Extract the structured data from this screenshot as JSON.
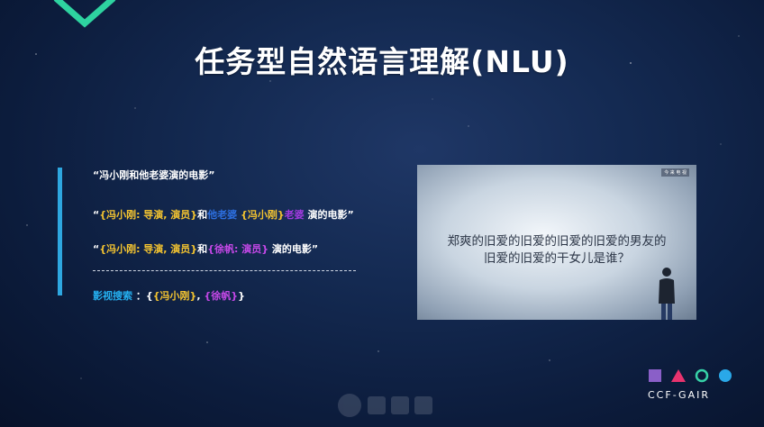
{
  "slide": {
    "title": "任务型自然语言理解(NLU)"
  },
  "examples": {
    "line1": "“冯小刚和他老婆演的电影”",
    "line2": {
      "open": "“",
      "seg1": "{冯小刚: 导演, 演员}",
      "seg2": "和",
      "seg3": "他老婆",
      "seg4": "{冯小刚}",
      "seg5": "老婆",
      "seg6": "演的电影”"
    },
    "line3": {
      "open": "“",
      "seg1": "{冯小刚: 导演, 演员}",
      "seg2": "和",
      "seg3": "{徐帆: 演员}",
      "seg4": "演的电影”"
    },
    "line4": {
      "seg1": "影视搜索",
      "seg2": "：{",
      "seg3": "{冯小刚}",
      "seg4": ",",
      "seg5": "{徐帆}",
      "seg6": "}"
    }
  },
  "video": {
    "logo": "今 来 电 视",
    "subtitle_line1": "郑爽的旧爱的旧爱的旧爱的旧爱的男友的",
    "subtitle_line2": "旧爱的旧爱的干女儿是谁？"
  },
  "conference": {
    "logo_text": "CCF-GAIR"
  },
  "colors": {
    "accent_green": "#2ed3a0",
    "bar_blue": "#2ea7e0",
    "entity_yellow": "#f4c430",
    "relation_blue": "#2d6fe0",
    "entity_purple": "#a23be0",
    "logo_square": "#8a5fc8",
    "logo_triangle": "#e8336e",
    "logo_circle_outline": "#37d2a8",
    "logo_circle_fill": "#2aa8e8"
  }
}
